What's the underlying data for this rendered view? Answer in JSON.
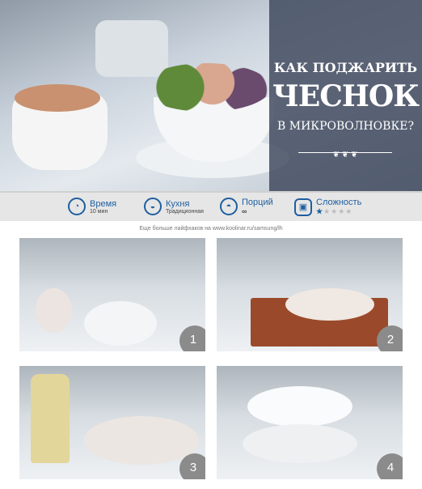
{
  "hero": {
    "title_line1": "КАК ПОДЖАРИТЬ",
    "title_line2": "ЧЕСНОК",
    "title_line3": "В МИКРОВОЛНОВКЕ?"
  },
  "info": [
    {
      "label": "Время",
      "value": "10 мин",
      "icon": "clock-icon"
    },
    {
      "label": "Кухня",
      "value": "Традиционная",
      "icon": "cuisine-icon"
    },
    {
      "label": "Порций",
      "value": "∞",
      "icon": "servings-icon"
    },
    {
      "label": "Сложность",
      "icon": "difficulty-icon",
      "rating": 1,
      "max": 5
    }
  ],
  "link_text": "Еще больше лайфхаков на www.koolinar.ru/samsung/lh",
  "steps": [
    {
      "number": "1"
    },
    {
      "number": "2"
    },
    {
      "number": "3"
    },
    {
      "number": "4"
    }
  ],
  "colors": {
    "accent": "#1f5fa0",
    "panel": "#3c465a"
  }
}
